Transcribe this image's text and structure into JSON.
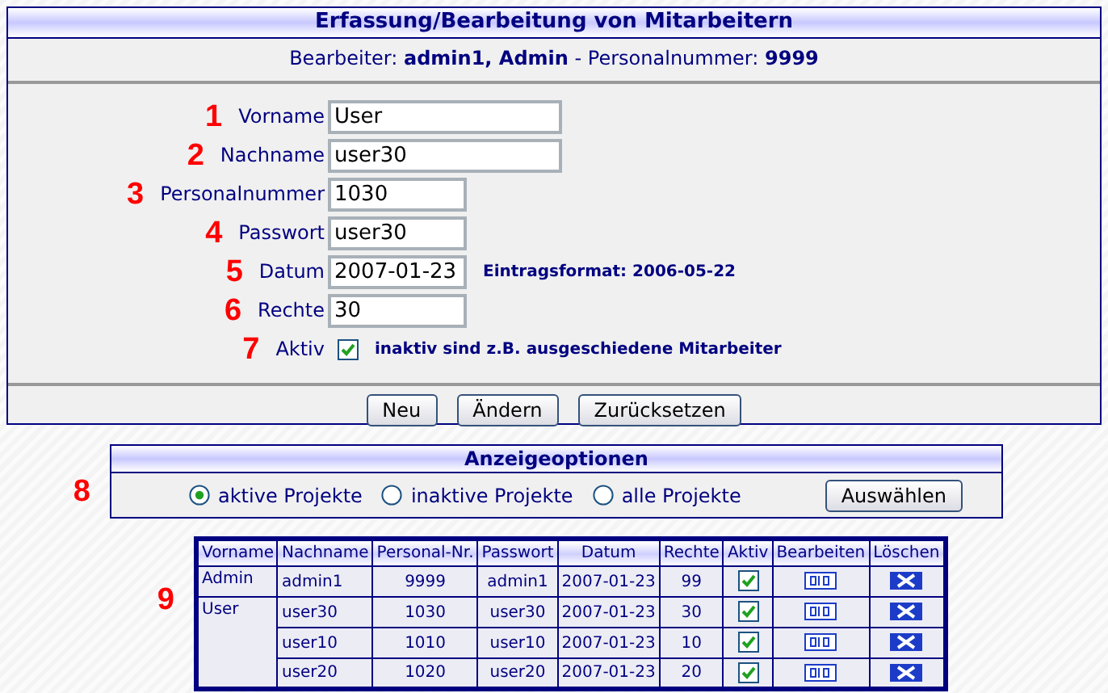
{
  "panel": {
    "title": "Erfassung/Bearbeitung von Mitarbeitern",
    "editor_line": {
      "editor_label": "Bearbeiter:",
      "editor": "admin1, Admin",
      "separator": "-",
      "number_label": "Personalnummer:",
      "number": "9999"
    }
  },
  "form": {
    "fields": [
      {
        "marker": "1",
        "label": "Vorname",
        "value": "User",
        "kind": "wide"
      },
      {
        "marker": "2",
        "label": "Nachname",
        "value": "user30",
        "kind": "wide"
      },
      {
        "marker": "3",
        "label": "Personalnummer",
        "value": "1030",
        "kind": "short"
      },
      {
        "marker": "4",
        "label": "Passwort",
        "value": "user30",
        "kind": "short"
      },
      {
        "marker": "5",
        "label": "Datum",
        "value": "2007-01-23",
        "kind": "short",
        "hint": "Eintragsformat: 2006-05-22"
      },
      {
        "marker": "6",
        "label": "Rechte",
        "value": "30",
        "kind": "short"
      },
      {
        "marker": "7",
        "label": "Aktiv",
        "checked": true,
        "kind": "checkbox",
        "hint": "inaktiv sind z.B. ausgeschiedene Mitarbeiter"
      }
    ],
    "buttons": [
      "Neu",
      "Ändern",
      "Zurücksetzen"
    ]
  },
  "options": {
    "marker": "8",
    "title": "Anzeigeoptionen",
    "radios": [
      {
        "label": "aktive Projekte",
        "selected": true
      },
      {
        "label": "inaktive Projekte",
        "selected": false
      },
      {
        "label": "alle Projekte",
        "selected": false
      }
    ],
    "button": "Auswählen"
  },
  "table": {
    "marker": "9",
    "columns": [
      "Vorname",
      "Nachname",
      "Personal-Nr.",
      "Passwort",
      "Datum",
      "Rechte",
      "Aktiv",
      "Bearbeiten",
      "Löschen"
    ],
    "groups": [
      {
        "vorname": "Admin",
        "rows": [
          {
            "nachname": "admin1",
            "nr": "9999",
            "passwort": "admin1",
            "datum": "2007-01-23",
            "rechte": "99",
            "aktiv": true
          }
        ]
      },
      {
        "vorname": "User",
        "rows": [
          {
            "nachname": "user30",
            "nr": "1030",
            "passwort": "user30",
            "datum": "2007-01-23",
            "rechte": "30",
            "aktiv": true
          },
          {
            "nachname": "user10",
            "nr": "1010",
            "passwort": "user10",
            "datum": "2007-01-23",
            "rechte": "10",
            "aktiv": true
          },
          {
            "nachname": "user20",
            "nr": "1020",
            "passwort": "user20",
            "datum": "2007-01-23",
            "rechte": "20",
            "aktiv": true
          }
        ]
      }
    ]
  }
}
